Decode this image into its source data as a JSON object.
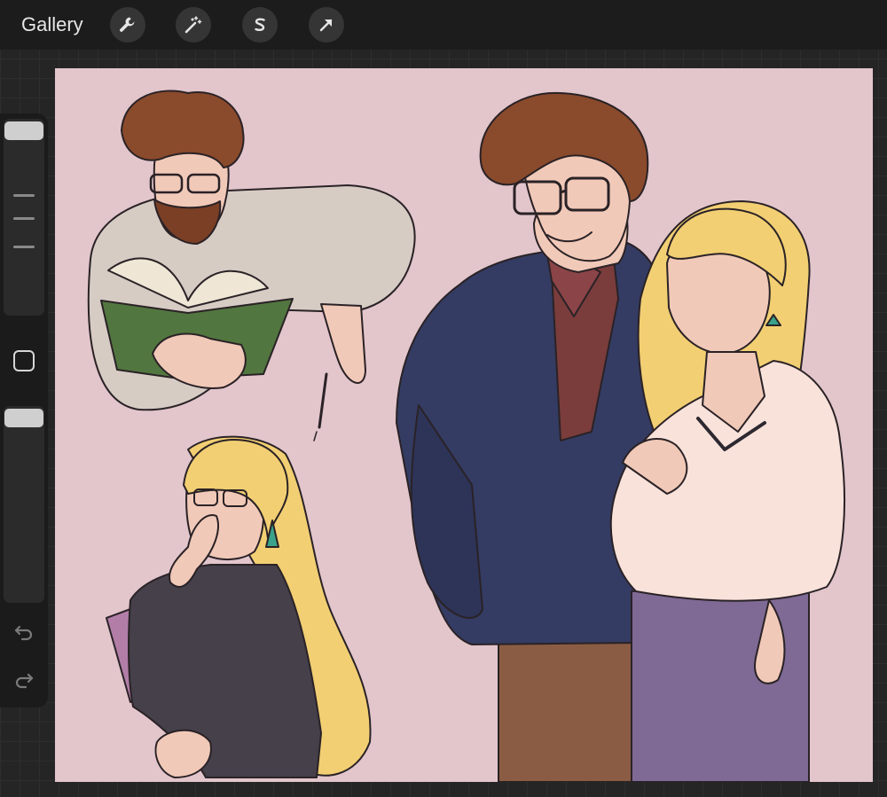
{
  "topbar": {
    "gallery_label": "Gallery",
    "tools": [
      {
        "name": "actions",
        "icon": "wrench-icon"
      },
      {
        "name": "adjustments",
        "icon": "magic-wand-icon"
      },
      {
        "name": "selection",
        "icon": "selection-s-icon"
      },
      {
        "name": "transform",
        "icon": "arrow-cursor-icon"
      }
    ]
  },
  "sidebar": {
    "controls": [
      "brush-size-slider",
      "modify-button",
      "opacity-slider",
      "undo-button",
      "redo-button"
    ]
  },
  "canvas": {
    "background_color": "#e2c6cc",
    "artwork": "character-sketches"
  },
  "colors": {
    "ui_dark": "#1c1c1c",
    "canvas_pink": "#e2c6cc",
    "hair_brown": "#8a4a2c",
    "hair_blonde": "#f2cf73",
    "jacket_navy": "#343c63",
    "skirt_purple": "#7e6a95"
  }
}
